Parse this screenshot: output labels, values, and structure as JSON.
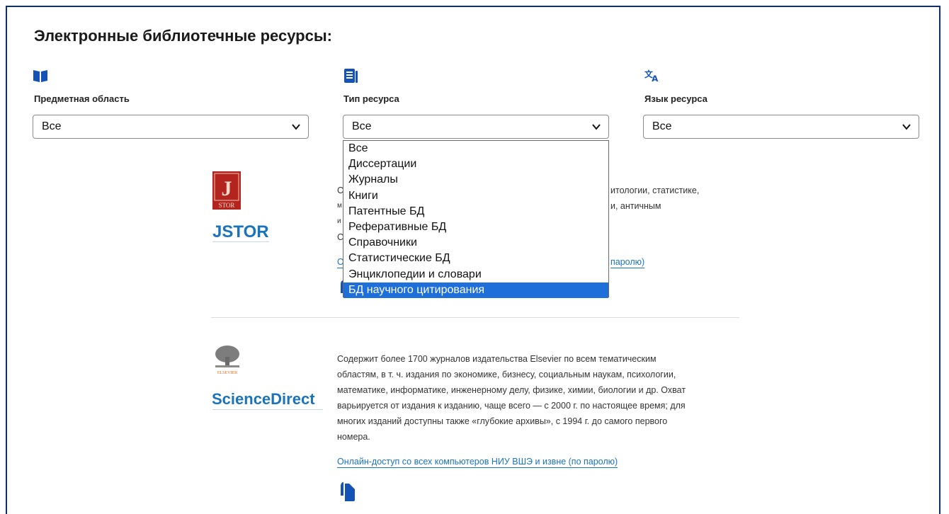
{
  "page": {
    "title": "Электронные библиотечные ресурсы:"
  },
  "filters": [
    {
      "label": "Предметная область",
      "value": "Все",
      "icon": "book-icon"
    },
    {
      "label": "Тип ресурса",
      "value": "Все",
      "icon": "document-list-icon"
    },
    {
      "label": "Язык ресурса",
      "value": "Все",
      "icon": "translate-icon"
    }
  ],
  "type_dropdown": {
    "options": [
      "Все",
      "Диссертации",
      "Журналы",
      "Книги",
      "Патентные БД",
      "Реферативные БД",
      "Справочники",
      "Статистические БД",
      "Энциклопедии и словари",
      "БД научного цитирования"
    ],
    "highlighted": "БД научного цитирования",
    "highlight_color": "#1e6fd9"
  },
  "resources": [
    {
      "name": "JSTOR",
      "logo_caption": "STOR",
      "desc_visible": [
        "С",
        "м",
        "и",
        "С"
      ],
      "desc_right": [
        "итологии, статистике,",
        "и, античным"
      ],
      "link_start": "О",
      "link_end": "паролю)"
    },
    {
      "name": "ScienceDirect",
      "logo_caption": "ELSEVIER",
      "description": [
        "Содержит более 1700 журналов издательства Elsevier по всем тематическим",
        "областям, в т. ч. издания по экономике, бизнесу, социальным наукам, психологии,",
        "математике, информатике, инженерному делу, физике, химии, биологии и др. Охват",
        "варьируется от издания к изданию, чаще всего — с 2000 г. по настоящее время; для",
        "многих изданий доступны также «глубокие архивы», с 1994 г. до самого первого",
        "номера."
      ],
      "link": "Онлайн-доступ со всех компьютеров НИУ ВШЭ и извне (по паролю)"
    }
  ],
  "colors": {
    "accent": "#1b74bb",
    "icon_blue": "#1552b5",
    "frame": "#0f2d69"
  }
}
